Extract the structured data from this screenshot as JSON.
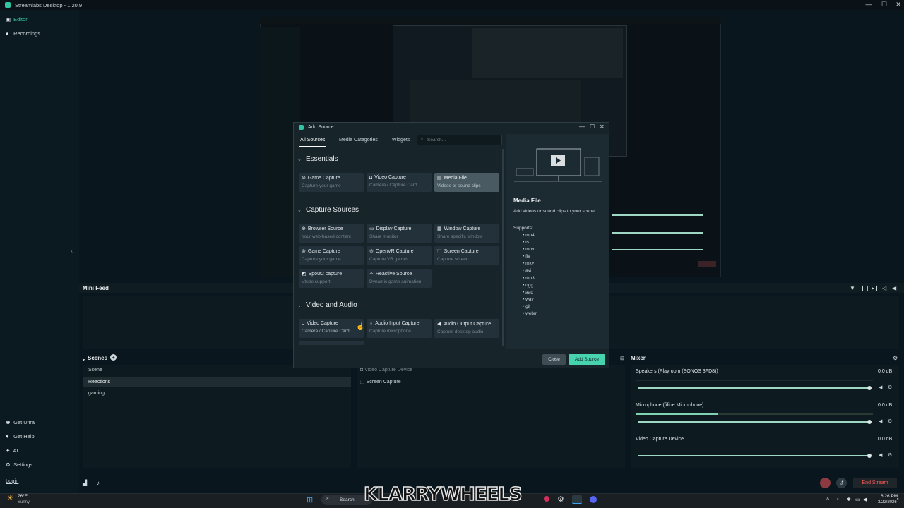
{
  "window": {
    "title": "Streamlabs Desktop - 1.20.9",
    "minimize": "—",
    "maximize": "☐",
    "close": "✕"
  },
  "nav": {
    "top": [
      {
        "label": "Editor",
        "icon": "editor-icon"
      },
      {
        "label": "Recordings",
        "icon": "recordings-icon"
      }
    ],
    "bottom": [
      {
        "label": "Get Ultra"
      },
      {
        "label": "Get Help"
      },
      {
        "label": "AI"
      },
      {
        "label": "Settings"
      }
    ],
    "login": "Login"
  },
  "minifeed": {
    "title": "Mini Feed"
  },
  "scenes": {
    "title": "Scenes",
    "add": "+",
    "items": [
      "Scene",
      "Reactions",
      "gaming"
    ],
    "selected": 1
  },
  "sources": {
    "items": [
      "Video Capture Device",
      "Screen Capture"
    ]
  },
  "mixer": {
    "title": "Mixer",
    "channels": [
      {
        "name": "Speakers (Playroom (SONOS 3FD8))",
        "db": "0.0 dB",
        "level": 1.0
      },
      {
        "name": "Microphone (fifine Microphone)",
        "db": "0.0 dB",
        "level": 1.0
      },
      {
        "name": "Video Capture Device",
        "db": "0.0 dB",
        "level": 1.0
      }
    ]
  },
  "status": {
    "end_stream": "End Stream"
  },
  "dialog": {
    "title": "Add Source",
    "tabs": [
      "All Sources",
      "Media Categories",
      "Widgets"
    ],
    "search_placeholder": "Search...",
    "sections": [
      {
        "title": "Essentials",
        "items": [
          {
            "name": "Game Capture",
            "desc": "Capture your game",
            "icon": "gamepad-icon"
          },
          {
            "name": "Video Capture",
            "desc": "Camera / Capture Card",
            "icon": "camera-icon"
          },
          {
            "name": "Media File",
            "desc": "Videos or sound clips",
            "icon": "file-icon"
          }
        ]
      },
      {
        "title": "Capture Sources",
        "items": [
          {
            "name": "Browser Source",
            "desc": "Your web-based content",
            "icon": "globe-icon"
          },
          {
            "name": "Display Capture",
            "desc": "Share monitor",
            "icon": "monitor-icon"
          },
          {
            "name": "Window Capture",
            "desc": "Share specific window",
            "icon": "window-icon"
          },
          {
            "name": "Game Capture",
            "desc": "Capture your game",
            "icon": "gamepad-icon"
          },
          {
            "name": "OpenVR Capture",
            "desc": "Capture VR games",
            "icon": "vr-icon"
          },
          {
            "name": "Screen Capture",
            "desc": "Capture screen",
            "icon": "screen-icon"
          },
          {
            "name": "Spout2 capture",
            "desc": "Vtube support",
            "icon": "spout-icon"
          },
          {
            "name": "Reactive Source",
            "desc": "Dynamic game animation",
            "icon": "sparkle-icon"
          }
        ]
      },
      {
        "title": "Video and Audio",
        "items": [
          {
            "name": "Video Capture",
            "desc": "Camera / Capture Card",
            "icon": "camera-icon"
          },
          {
            "name": "Audio Input Capture",
            "desc": "Capture microphone",
            "icon": "mic-icon"
          },
          {
            "name": "Audio Output Capture",
            "desc": "Capture desktop audio",
            "icon": "speaker-icon"
          }
        ]
      }
    ],
    "detail": {
      "title": "Media File",
      "desc": "Add videos or sound clips to your scene.",
      "supports_label": "Supports:",
      "formats": [
        "mp4",
        "ts",
        "mov",
        "flv",
        "mkv",
        "avi",
        "mp3",
        "ogg",
        "aac",
        "wav",
        "gif",
        "webm"
      ]
    },
    "close": "Close",
    "add": "Add Source"
  },
  "taskbar": {
    "weather_temp": "76°F",
    "weather_text": "Sunny",
    "search": "Search",
    "watermark": "KLARRYWHEELS",
    "time": "6:26 PM",
    "date": "3/22/2026"
  },
  "colors": {
    "accent": "#31c3a2",
    "add_button": "#47d3ad",
    "end_stream": "#ff5a5a"
  }
}
